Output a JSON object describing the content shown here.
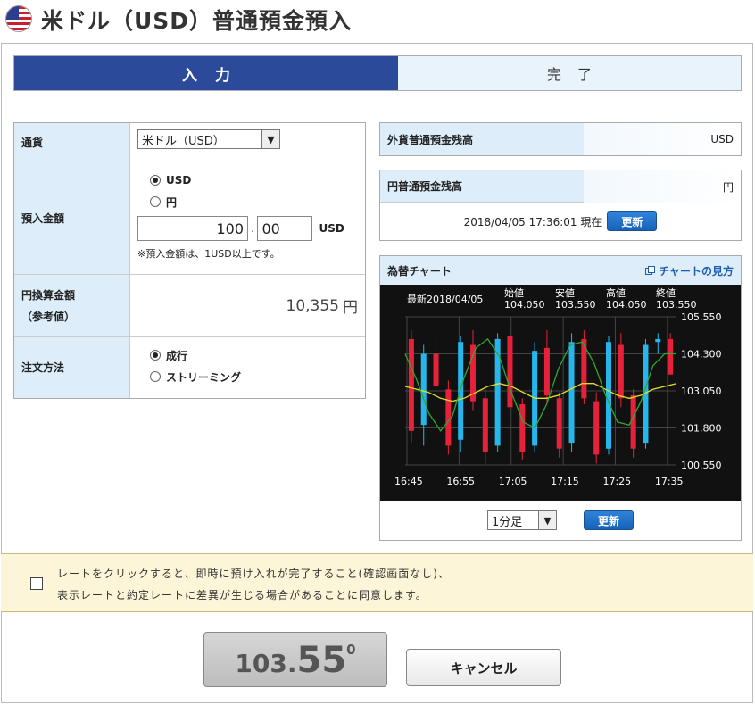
{
  "header": {
    "title": "米ドル（USD）普通預金預入"
  },
  "steps": {
    "active": "入力",
    "next": "完了"
  },
  "form": {
    "currency_label": "通貨",
    "currency_value": "米ドル（USD）",
    "amount_label": "預入金額",
    "unit_usd": "USD",
    "unit_yen": "円",
    "amount_int": "100",
    "amount_dec": "00",
    "amount_unit": "USD",
    "amount_note": "※預入金額は、1USD以上です。",
    "yen_label_1": "円換算金額",
    "yen_label_2": "（参考値）",
    "yen_value": "10,355",
    "yen_unit": "円",
    "order_label": "注文方法",
    "order_market": "成行",
    "order_streaming": "ストリーミング"
  },
  "balances": {
    "fx_label": "外貨普通預金残高",
    "fx_unit": "USD",
    "yen_label": "円普通預金残高",
    "yen_unit": "円",
    "timestamp": "2018/04/05 17:36:01 現在",
    "update": "更新"
  },
  "chart": {
    "title": "為替チャート",
    "help": "チャートの見方",
    "latest": "最新2018/04/05",
    "headers": [
      "始値",
      "安値",
      "高値",
      "終値"
    ],
    "prices": [
      "104.050",
      "103.550",
      "104.050",
      "103.550"
    ],
    "interval": "1分足",
    "update": "更新"
  },
  "chart_data": {
    "type": "line",
    "y_ticks": [
      "105.550",
      "104.300",
      "103.050",
      "101.800",
      "100.550"
    ],
    "ylim": [
      100.55,
      105.55
    ],
    "x_ticks": [
      "16:45",
      "16:55",
      "17:05",
      "17:15",
      "17:25",
      "17:35"
    ],
    "candles": [
      [
        104.8,
        105.1,
        101.3,
        101.7
      ],
      [
        101.9,
        104.6,
        101.2,
        104.3
      ],
      [
        104.3,
        105.0,
        103.0,
        103.2
      ],
      [
        103.1,
        103.4,
        100.9,
        101.2
      ],
      [
        101.4,
        104.9,
        101.0,
        104.7
      ],
      [
        104.6,
        105.1,
        102.4,
        102.7
      ],
      [
        102.8,
        103.1,
        100.6,
        101.0
      ],
      [
        101.2,
        105.0,
        101.0,
        104.8
      ],
      [
        104.9,
        105.2,
        102.3,
        102.5
      ],
      [
        102.6,
        102.8,
        100.7,
        101.0
      ],
      [
        101.2,
        104.7,
        101.0,
        104.4
      ],
      [
        104.5,
        105.1,
        102.6,
        102.9
      ],
      [
        102.8,
        103.0,
        100.8,
        101.1
      ],
      [
        101.3,
        105.0,
        101.0,
        104.7
      ],
      [
        104.8,
        105.1,
        102.6,
        102.8
      ],
      [
        102.7,
        103.0,
        100.6,
        100.9
      ],
      [
        101.1,
        104.9,
        100.9,
        104.7
      ],
      [
        104.6,
        105.0,
        102.5,
        102.8
      ],
      [
        102.9,
        103.1,
        100.8,
        101.1
      ],
      [
        101.3,
        104.8,
        101.1,
        104.6
      ],
      [
        104.7,
        105.0,
        104.3,
        104.8
      ],
      [
        104.8,
        105.0,
        103.6,
        103.6
      ]
    ],
    "ma_green": [
      104.3,
      103.4,
      102.3,
      101.7,
      102.2,
      103.5,
      104.5,
      104.8,
      104.2,
      103.0,
      102.0,
      101.8,
      102.6,
      103.8,
      104.6,
      104.7,
      104.0,
      102.9,
      102.0,
      101.9,
      102.7,
      103.9,
      104.3,
      104.3
    ],
    "ma_yellow": [
      103.2,
      103.1,
      103.0,
      102.8,
      102.7,
      102.8,
      103.0,
      103.2,
      103.3,
      103.2,
      103.0,
      102.8,
      102.8,
      102.9,
      103.1,
      103.3,
      103.3,
      103.1,
      102.9,
      102.8,
      102.9,
      103.1,
      103.2,
      103.3
    ]
  },
  "consent": {
    "line1": "レートをクリックすると、即時に預け入れが完了すること(確認画面なし)、",
    "line2": "表示レートと約定レートに差異が生じる場合があることに同意します。"
  },
  "rate": {
    "small": "103.",
    "big": "55",
    "sup": "0"
  },
  "cancel": "キャンセル",
  "colors": {
    "brand": "#2b4a9a",
    "up": "#e8213b",
    "down": "#27b6ec",
    "ma1": "#2ea82e",
    "ma2": "#e6dd2a"
  }
}
